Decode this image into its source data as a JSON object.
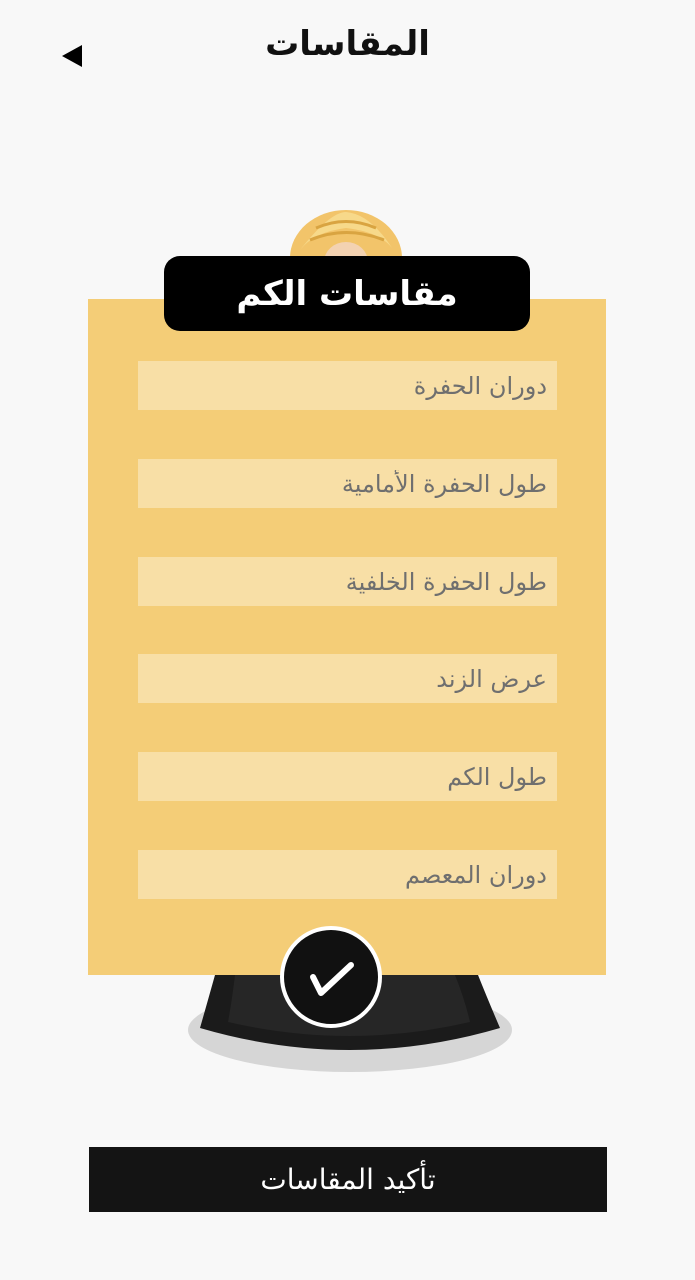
{
  "header": {
    "title": "المقاسات",
    "back_icon": "back-triangle-icon"
  },
  "card": {
    "title": "مقاسات الكم",
    "fields": [
      {
        "placeholder": "دوران الحفرة",
        "value": ""
      },
      {
        "placeholder": "طول الحفرة الأمامية",
        "value": ""
      },
      {
        "placeholder": "طول الحفرة الخلفية",
        "value": ""
      },
      {
        "placeholder": "عرض الزند",
        "value": ""
      },
      {
        "placeholder": "طول الكم",
        "value": ""
      },
      {
        "placeholder": "دوران المعصم",
        "value": ""
      }
    ],
    "check_icon": "checkmark-icon"
  },
  "footer": {
    "confirm_label": "تأكيد المقاسات"
  },
  "colors": {
    "background": "#f8f8f8",
    "card": "#f4cd77",
    "field": "#f8dfa6",
    "dark": "#111111",
    "hair": "#f2c46a"
  }
}
